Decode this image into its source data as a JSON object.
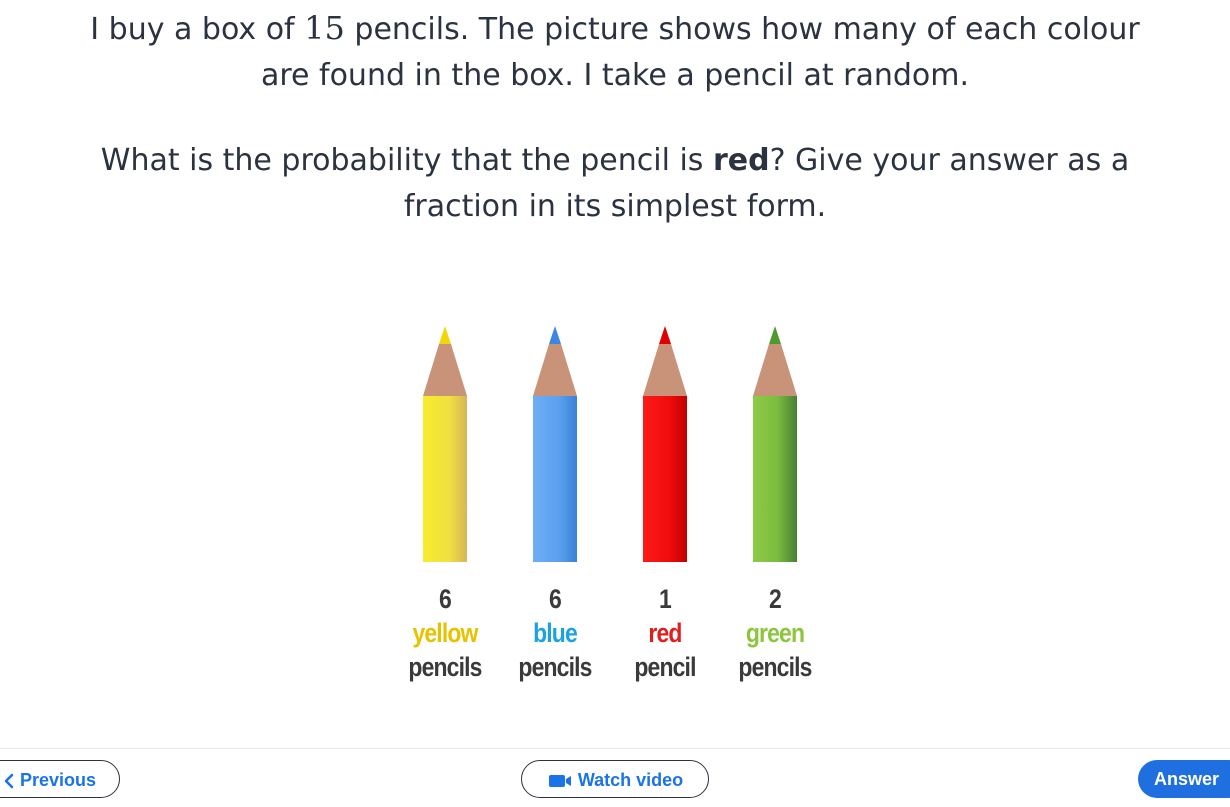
{
  "question": {
    "line1_pre": "I buy a box of ",
    "line1_num": "15",
    "line1_post": " pencils. The picture shows how many of each colour",
    "line2": "are found in the box. I take a pencil at random.",
    "line3_pre": "What is the probability that the pencil is ",
    "line3_bold": "red",
    "line3_post": "? Give your answer as a",
    "line4": "fraction in its simplest form."
  },
  "pencils": [
    {
      "count": "6",
      "colour": "yellow",
      "noun": "pencils",
      "label_color": "#e6c300",
      "body": "#f5e53a",
      "shade": "#d9b84a"
    },
    {
      "count": "6",
      "colour": "blue",
      "noun": "pencils",
      "label_color": "#1aa3e0",
      "body": "#5aa2ee",
      "shade": "#3d86d8"
    },
    {
      "count": "1",
      "colour": "red",
      "noun": "pencil",
      "label_color": "#e01e1e",
      "body": "#f01010",
      "shade": "#c40000"
    },
    {
      "count": "2",
      "colour": "green",
      "noun": "pencils",
      "label_color": "#8cc63f",
      "body": "#86c440",
      "shade": "#4a8a3a"
    }
  ],
  "footer": {
    "previous_label": "Previous",
    "video_label": "Watch video",
    "answer_label": "Answer"
  }
}
